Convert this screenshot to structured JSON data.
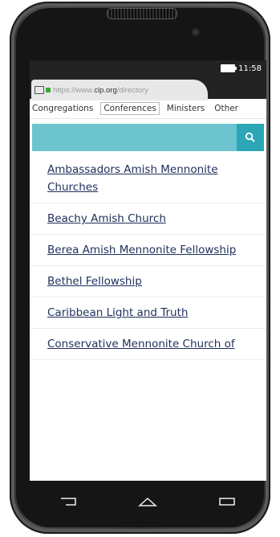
{
  "statusbar": {
    "time": "11:58"
  },
  "browser": {
    "url_prefix": "https://www.",
    "url_host": "clp.org",
    "url_path": "/directory"
  },
  "tabs": [
    {
      "label": "Congregations"
    },
    {
      "label": "Conferences",
      "active": true
    },
    {
      "label": "Ministers"
    },
    {
      "label": "Other"
    }
  ],
  "search": {
    "placeholder": ""
  },
  "list": [
    {
      "label": "Ambassadors Amish Mennonite Churches"
    },
    {
      "label": "Beachy Amish Church"
    },
    {
      "label": "Berea Amish Mennonite Fellowship"
    },
    {
      "label": "Bethel Fellowship"
    },
    {
      "label": "Caribbean Light and Truth"
    },
    {
      "label": "Conservative Mennonite Church of"
    }
  ],
  "icons": {
    "search": "search-icon",
    "back": "back-icon",
    "home": "home-icon",
    "recent": "recent-apps-icon"
  },
  "colors": {
    "search_bar": "#6cc4cf",
    "search_button": "#2ba7b5",
    "link": "#1f2f5c"
  }
}
